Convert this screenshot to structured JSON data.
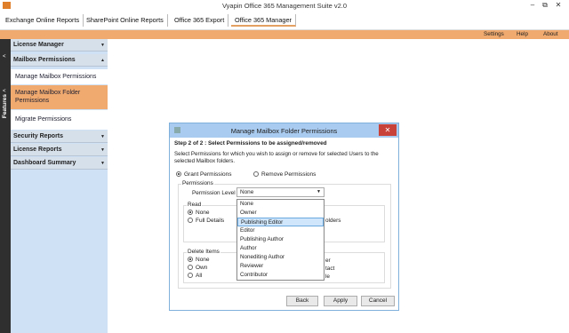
{
  "window": {
    "title": "Vyapin Office 365 Management Suite v2.0",
    "minimize": "–",
    "restore": "⧉",
    "close": "✕"
  },
  "topnav": [
    "Exchange Online Reports",
    "SharePoint Online Reports",
    "Office 365 Export",
    "Office 365 Manager"
  ],
  "util": {
    "settings": "Settings",
    "help": "Help",
    "about": "About"
  },
  "strip": {
    "label": "Features",
    "arrow": "<"
  },
  "sidebar": {
    "license_manager": "License Manager",
    "mailbox_permissions": "Mailbox Permissions",
    "manage_mailbox_permissions": "Manage Mailbox Permissions",
    "manage_mailbox_folder_permissions": "Manage Mailbox Folder Permissions",
    "migrate_permissions": "Migrate Permissions",
    "security_reports": "Security Reports",
    "license_reports": "License Reports",
    "dashboard_summary": "Dashboard Summary"
  },
  "dialog": {
    "title": "Manage Mailbox Folder Permissions",
    "step": "Step 2 of 2 : Select Permissions to be assigned/removed",
    "description": "Select Permissions for which you wish to assign or remove for selected Users to the selected Mailbox folders.",
    "grant": "Grant Permissions",
    "remove": "Remove Permissions",
    "permissions_group": "Permissions",
    "permission_level_label": "Permission Level :",
    "permission_level_value": "None",
    "read": {
      "label": "Read",
      "none": "None",
      "full": "Full Details",
      "partial": "olders"
    },
    "delete": {
      "label": "Delete Items",
      "none": "None",
      "own": "Own",
      "all": "All",
      "right1": "er",
      "right2": "tact",
      "right3": "le"
    },
    "dropdown_options": [
      "None",
      "Owner",
      "Publishing Editor",
      "Editor",
      "Publishing Author",
      "Author",
      "Nonediting Author",
      "Reviewer",
      "Contributor"
    ],
    "back": "Back",
    "apply": "Apply",
    "cancel": "Cancel"
  }
}
